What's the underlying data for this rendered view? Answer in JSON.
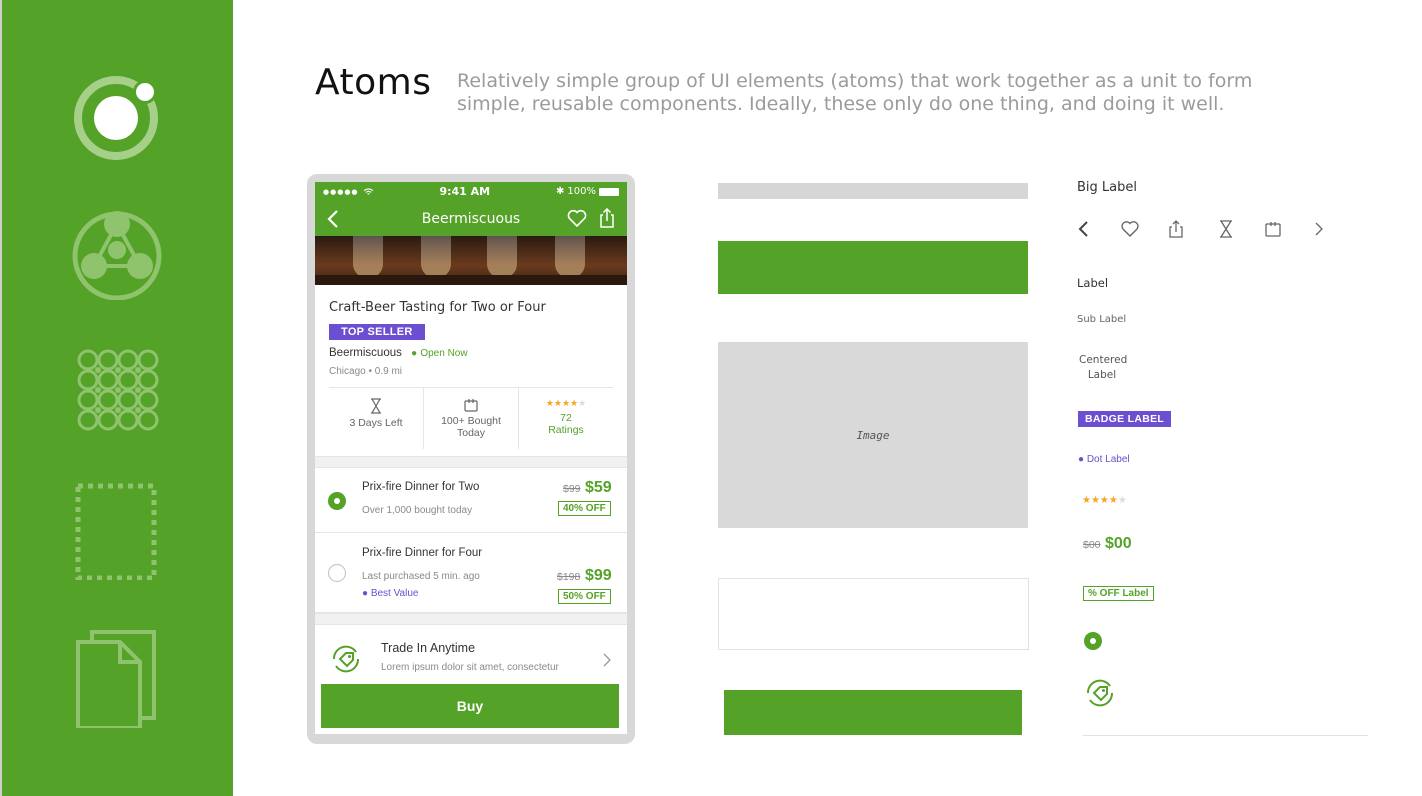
{
  "header": {
    "title": "Atoms",
    "description_line1": "Relatively simple group of UI elements (atoms) that work together as a unit to form",
    "description_line2": "simple, reusable components. Ideally, these only do one thing, and doing it well."
  },
  "colors": {
    "brand_green": "#55a228",
    "badge_purple": "#6c4ed1",
    "star_gold": "#f5a623",
    "placeholder_gray": "#d9d9d9"
  },
  "sidebar": {
    "icons": [
      "ionic-logo-icon",
      "molecules-icon",
      "organisms-icon",
      "templates-icon",
      "pages-icon"
    ]
  },
  "phone": {
    "status": {
      "signal": "●●●●●",
      "time": "9:41 AM",
      "battery": "100%"
    },
    "nav_title": "Beermiscuous",
    "deal": {
      "title": "Craft-Beer Tasting for Two or Four",
      "badge": "TOP SELLER",
      "merchant": "Beermiscuous",
      "open_status": "Open Now",
      "location": "Chicago",
      "distance": "0.9 mi"
    },
    "stats": {
      "time_left": "3 Days Left",
      "bought_line1": "100+ Bought",
      "bought_line2": "Today",
      "ratings_count": "72",
      "ratings_label": "Ratings",
      "rating_value": 4
    },
    "options": [
      {
        "name": "Prix-fire Dinner for Two",
        "sub": "Over 1,000 bought today",
        "old_price": "$99",
        "new_price": "$59",
        "off": "40% OFF",
        "selected": true
      },
      {
        "name": "Prix-fire Dinner for Four",
        "sub": "Last purchased 5 min. ago",
        "extra": "Best Value",
        "old_price": "$198",
        "new_price": "$99",
        "off": "50% OFF",
        "selected": false
      }
    ],
    "trade": {
      "title": "Trade In Anytime",
      "text": "Lorem ipsum dolor sit amet, consectetur"
    },
    "buy_label": "Buy"
  },
  "middle": {
    "image_label": "Image"
  },
  "right": {
    "big_label": "Big Label",
    "label": "Label",
    "sub_label": "Sub Label",
    "centered_line1": "Centered",
    "centered_line2": "Label",
    "badge_label": "BADGE LABEL",
    "dot_label": "Dot Label",
    "rating_value": 4,
    "old_price": "$00",
    "new_price": "$00",
    "off_label": "% OFF Label",
    "icons": [
      "back-chevron-icon",
      "heart-icon",
      "share-icon",
      "hourglass-icon",
      "gift-card-icon",
      "forward-chevron-icon"
    ]
  }
}
